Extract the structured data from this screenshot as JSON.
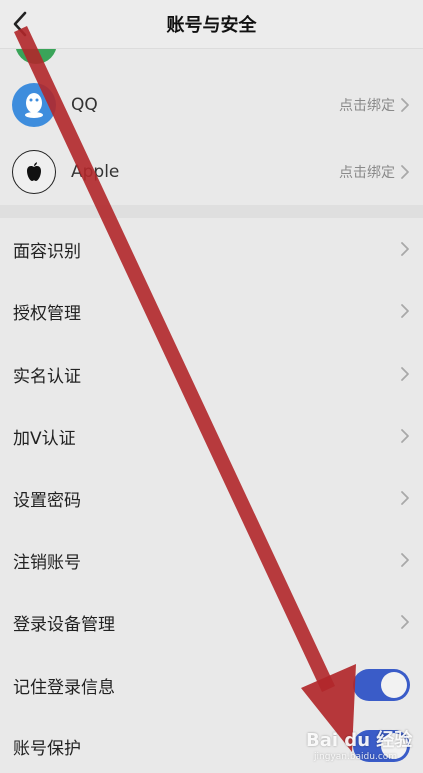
{
  "header": {
    "title": "账号与安全"
  },
  "accounts": [
    {
      "name": "QQ",
      "action": "点击绑定",
      "icon": "qq-icon"
    },
    {
      "name": "Apple",
      "action": "点击绑定",
      "icon": "apple-icon"
    }
  ],
  "settings": [
    {
      "label": "面容识别"
    },
    {
      "label": "授权管理"
    },
    {
      "label": "实名认证"
    },
    {
      "label": "加V认证"
    },
    {
      "label": "设置密码"
    },
    {
      "label": "注销账号"
    },
    {
      "label": "登录设备管理"
    }
  ],
  "toggles": [
    {
      "label": "记住登录信息",
      "on": true
    },
    {
      "label": "账号保护",
      "on": true
    }
  ],
  "watermark": {
    "main": "Bai du 经验",
    "sub": "jingyan.baidu.com"
  },
  "colors": {
    "toggle_on": "#3a5cc8",
    "annotation_arrow": "#b1272a",
    "qq": "#3e8ddd"
  }
}
